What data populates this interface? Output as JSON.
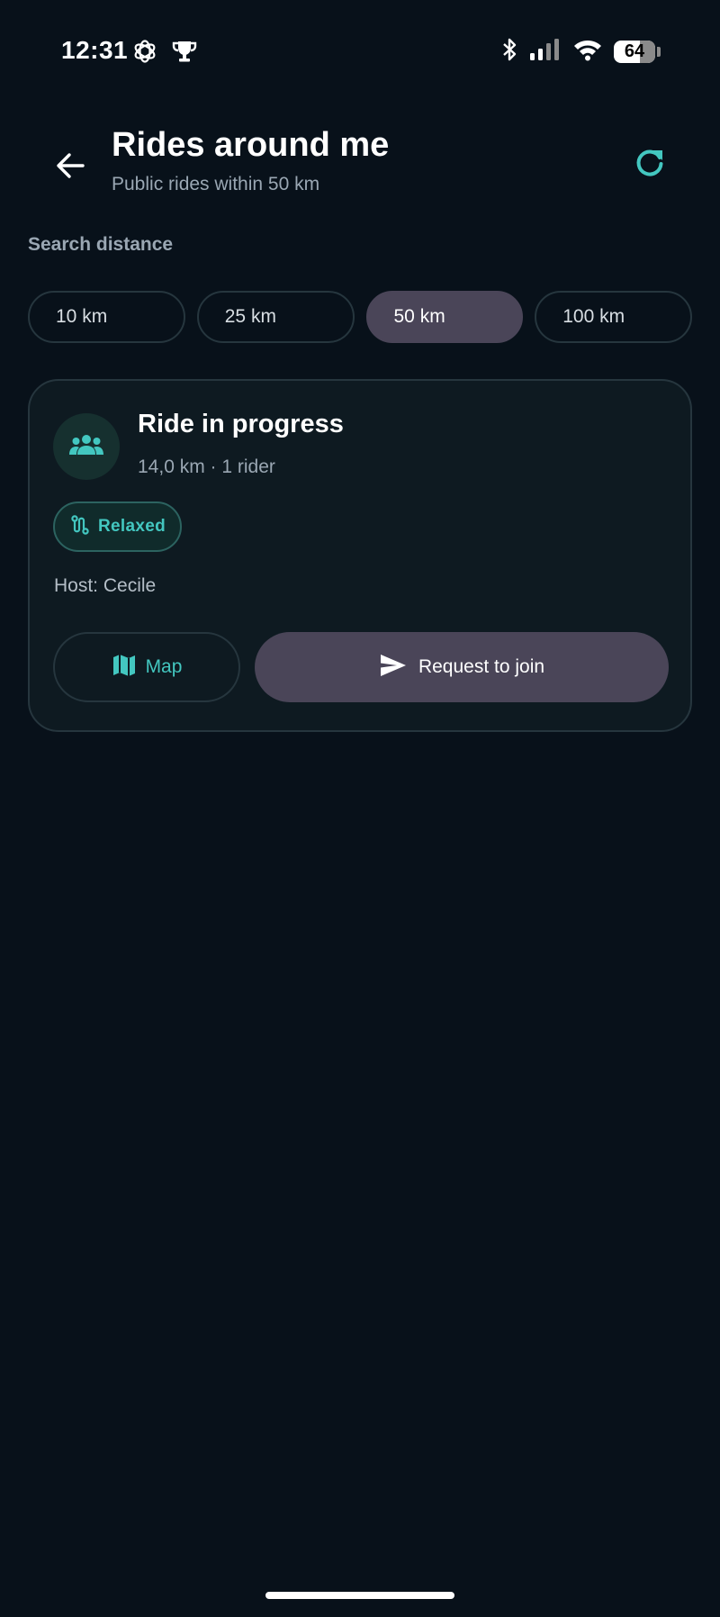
{
  "status_bar": {
    "time": "12:31",
    "left_icons": [
      "openai-icon",
      "trophy-icon"
    ],
    "right_icons": [
      "bluetooth-icon",
      "signal-icon",
      "wifi-icon"
    ],
    "battery_level": "64",
    "battery_fraction": 0.64
  },
  "header": {
    "title": "Rides around me",
    "subtitle": "Public rides within 50 km",
    "back_icon": "arrow-back-icon",
    "refresh_icon": "refresh-icon"
  },
  "search_distance": {
    "label": "Search distance",
    "options": [
      "10 km",
      "25 km",
      "50 km",
      "100 km"
    ],
    "selected": "50 km"
  },
  "ride": {
    "title": "Ride in progress",
    "meta": "14,0 km · 1 rider",
    "pace": "Relaxed",
    "host": "Host: Cecile",
    "map_label": "Map",
    "join_label": "Request to join",
    "avatar_icon": "group-icon",
    "pace_icon": "route-icon",
    "map_icon": "map-icon",
    "join_icon": "send-icon"
  },
  "colors": {
    "background": "#08111a",
    "card": "#0e1a21",
    "accent": "#43c7c0",
    "selected": "#4a4558",
    "muted_text": "#9aa7b3"
  }
}
